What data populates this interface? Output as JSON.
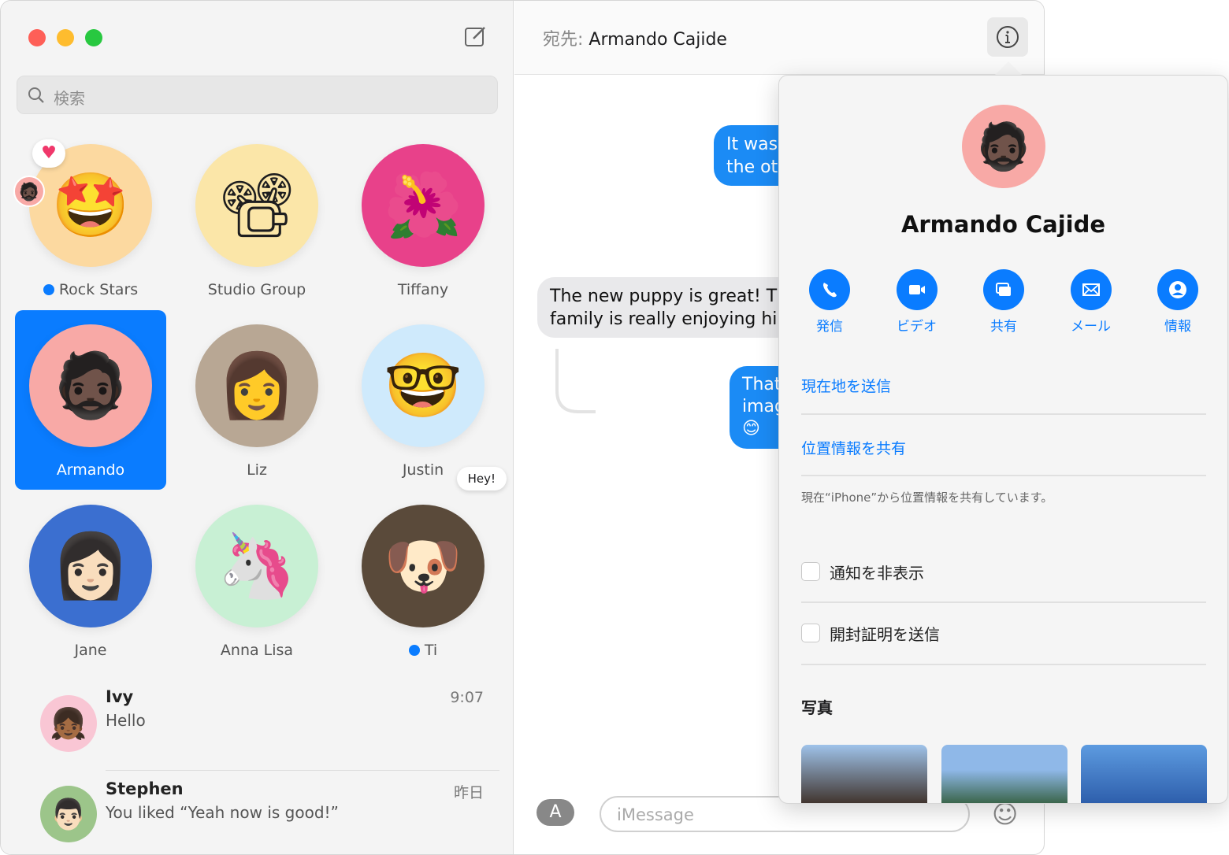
{
  "sidebar": {
    "search_placeholder": "検索",
    "pinned": [
      {
        "name": "Rock Stars",
        "unread": true,
        "bg": "#fcd9a0",
        "emoji": "🤩"
      },
      {
        "name": "Studio Group",
        "unread": false,
        "bg": "#fbe6a8",
        "emoji": "📽"
      },
      {
        "name": "Tiffany",
        "unread": false,
        "bg": "#e8418a",
        "emoji": "🌺"
      },
      {
        "name": "Armando",
        "unread": false,
        "bg": "#f8a9a6",
        "emoji": "🧔🏿",
        "selected": true
      },
      {
        "name": "Liz",
        "unread": false,
        "bg": "#b8a794",
        "emoji": "👩"
      },
      {
        "name": "Justin",
        "unread": false,
        "bg": "#cfeafc",
        "emoji": "🤓"
      },
      {
        "name": "Jane",
        "unread": false,
        "bg": "#3b6fd0",
        "emoji": "👩🏻"
      },
      {
        "name": "Anna Lisa",
        "unread": false,
        "bg": "#c8f0d4",
        "emoji": "🦄"
      },
      {
        "name": "Ti",
        "unread": true,
        "bg": "#5a4a3a",
        "emoji": "🐶",
        "bubble": "Hey!"
      }
    ],
    "conversations": [
      {
        "name": "Ivy",
        "message": "Hello",
        "time": "9:07",
        "emoji": "👧🏾",
        "bg": "#f9c6d4"
      },
      {
        "name": "Stephen",
        "message": "You liked “Yeah now is good!”",
        "time": "昨日",
        "emoji": "👨🏻",
        "bg": "#9cc58a"
      }
    ]
  },
  "header": {
    "to_label": "宛先:",
    "recipient": "Armando Cajide"
  },
  "messages": [
    {
      "dir": "out",
      "lines": [
        "It was",
        "the ot"
      ]
    },
    {
      "dir": "in",
      "lines": [
        "The new puppy is great! Th",
        "family is really enjoying him"
      ]
    },
    {
      "dir": "out",
      "lines": [
        "That",
        "imag",
        "😊"
      ]
    }
  ],
  "composer": {
    "placeholder": "iMessage"
  },
  "details": {
    "name": "Armando Cajide",
    "actions": [
      {
        "label": "発信",
        "icon": "phone-icon"
      },
      {
        "label": "ビデオ",
        "icon": "video-icon"
      },
      {
        "label": "共有",
        "icon": "screen-share-icon"
      },
      {
        "label": "メール",
        "icon": "mail-icon"
      },
      {
        "label": "情報",
        "icon": "contact-info-icon"
      }
    ],
    "send_location": "現在地を送信",
    "share_location": "位置情報を共有",
    "sharing_note": "現在“iPhone”から位置情報を共有しています。",
    "hide_alerts": "通知を非表示",
    "send_receipts": "開封証明を送信",
    "photos_title": "写真"
  },
  "colors": {
    "accent": "#0a7cff",
    "bubble_out": "#1b8bf5",
    "bubble_in": "#e9e9eb"
  }
}
